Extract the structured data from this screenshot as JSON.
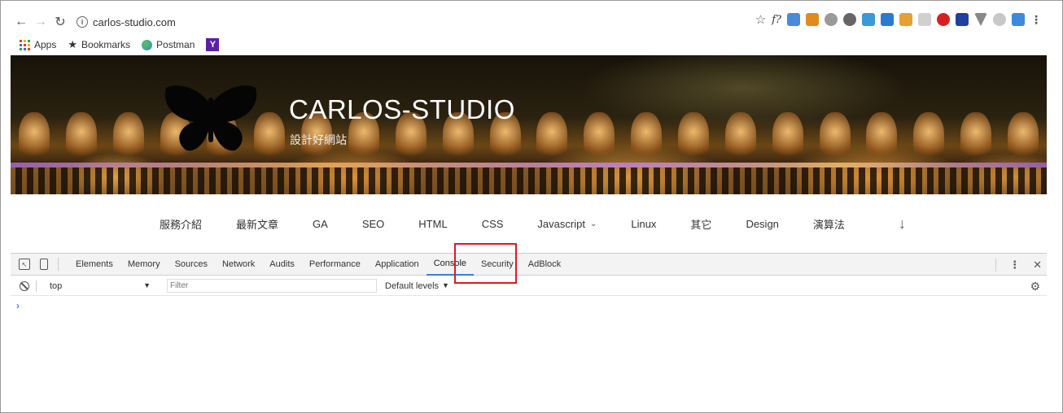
{
  "browser": {
    "url": "carlos-studio.com",
    "bookmarks": [
      {
        "label": "Apps"
      },
      {
        "label": "Bookmarks"
      },
      {
        "label": "Postman"
      }
    ]
  },
  "site": {
    "title": "CARLOS-STUDIO",
    "subtitle": "設計好網站",
    "nav": [
      {
        "label": "服務介紹"
      },
      {
        "label": "最新文章"
      },
      {
        "label": "GA"
      },
      {
        "label": "SEO"
      },
      {
        "label": "HTML"
      },
      {
        "label": "CSS"
      },
      {
        "label": "Javascript"
      },
      {
        "label": "Linux"
      },
      {
        "label": "其它"
      },
      {
        "label": "Design"
      },
      {
        "label": "演算法"
      }
    ]
  },
  "devtools": {
    "tabs": [
      "Elements",
      "Memory",
      "Sources",
      "Network",
      "Audits",
      "Performance",
      "Application",
      "Console",
      "Security",
      "AdBlock"
    ],
    "active_tab": "Console",
    "context": "top",
    "filter_placeholder": "Filter",
    "levels_label": "Default levels",
    "highlight_color": "#e0191e",
    "accent_color": "#3d7de0"
  }
}
